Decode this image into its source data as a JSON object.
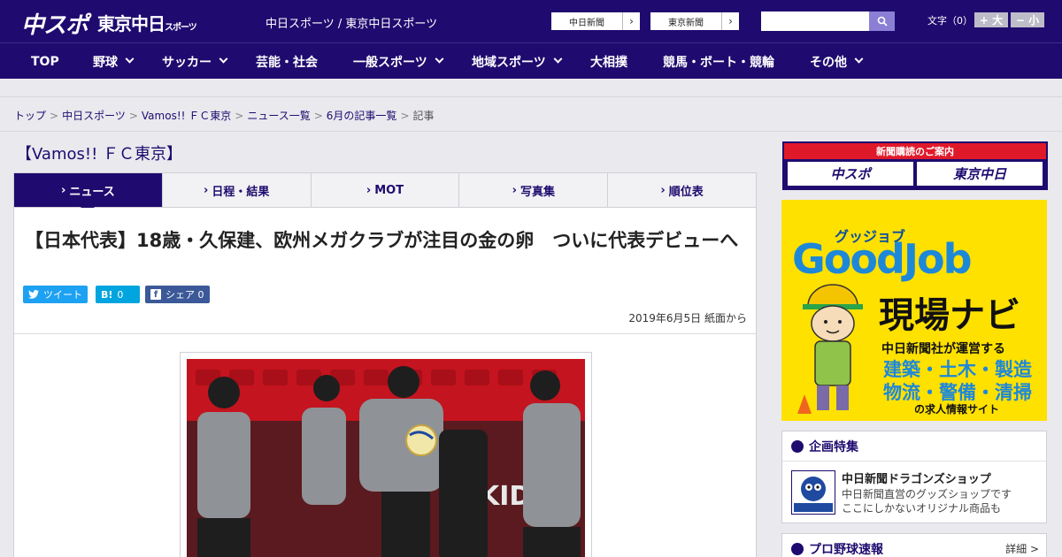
{
  "header": {
    "logo_main": "中スポ",
    "logo_tokyo": "東京中日",
    "logo_tokyo_small": "スポーツ",
    "tagline": "中日スポーツ / 東京中日スポーツ",
    "paper_buttons": [
      {
        "label": "中日新聞",
        "arrow": "›"
      },
      {
        "label": "東京新聞",
        "arrow": "›"
      }
    ],
    "search_placeholder": "",
    "font_size_label": "文字（0）",
    "font_bigger": "+ 大",
    "font_smaller": "− 小"
  },
  "nav": {
    "items": [
      {
        "label": "TOP"
      },
      {
        "label": "野球"
      },
      {
        "label": "サッカー"
      },
      {
        "label": "芸能・社会"
      },
      {
        "label": "一般スポーツ"
      },
      {
        "label": "地域スポーツ"
      },
      {
        "label": "大相撲"
      },
      {
        "label": "競馬・ボート・競輪"
      },
      {
        "label": "その他"
      }
    ]
  },
  "breadcrumb": {
    "items": [
      "トップ",
      "中日スポーツ",
      "Vamos!! ＦＣ東京",
      "ニュース一覧",
      "6月の記事一覧"
    ],
    "current": "記事",
    "separator": ">"
  },
  "section": {
    "title": "【Vamos!! ＦＣ東京】",
    "tabs": [
      {
        "label": "ニュース",
        "active": true
      },
      {
        "label": "日程・結果",
        "active": false
      },
      {
        "label": "MOT",
        "active": false
      },
      {
        "label": "写真集",
        "active": false
      },
      {
        "label": "順位表",
        "active": false
      }
    ],
    "tab_marker": "›"
  },
  "article": {
    "headline": "【日本代表】18歳・久保建、欧州メガクラブが注目の金の卵　ついに代表デビューへ",
    "share": {
      "tweet_label": "ツイート",
      "hatena_icon": "B!",
      "hatena_count": "0",
      "facebook_label": "シェア",
      "facebook_count": "0"
    },
    "date": "2019年6月5日 紙面から"
  },
  "sidebar": {
    "subscribe_header": "新聞購読のご案内",
    "subscribe_logos": [
      "中スポ",
      "東京中日"
    ],
    "ad": {
      "kana": "グッジョブ",
      "brand": "GoodJob",
      "navi": "現場ナビ",
      "run_by": "中日新聞社が運営する",
      "line1": "建築・土木・製造",
      "line2": "物流・警備・清掃",
      "sub": "の求人情報サイト"
    },
    "feature_panel": {
      "title": "企画特集",
      "shop_title": "中日新聞ドラゴンズショップ",
      "shop_desc_1": "中日新聞直営のグッズショップです",
      "shop_desc_2": "ここにしかないオリジナル商品も"
    },
    "baseball_panel": {
      "title": "プロ野球速報",
      "more": "詳細 >"
    }
  },
  "colors": {
    "brand_navy": "#1f0b6f",
    "accent_red": "#e0192a",
    "twitter": "#1da1f2",
    "hatena": "#00a4de",
    "facebook": "#3b5998",
    "ad_yellow": "#ffe100"
  }
}
